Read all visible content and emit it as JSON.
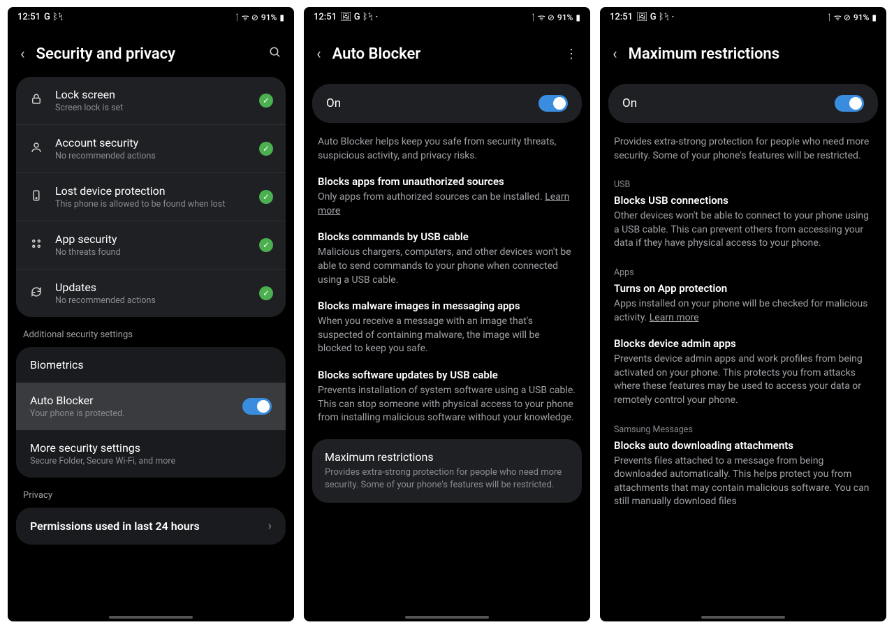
{
  "status": {
    "time": "12:51",
    "battery_text": "91%",
    "left_icons": "G ᛒᛪ",
    "left_icons2": "🖼 G ᛒᛪ ·",
    "left_icons3": "🖼 G ᛒᛪ ·",
    "right_icons": "ᛙ ᯤ ⊘"
  },
  "screen1": {
    "title": "Security and privacy",
    "items": [
      {
        "title": "Lock screen",
        "sub": "Screen lock is set"
      },
      {
        "title": "Account security",
        "sub": "No recommended actions"
      },
      {
        "title": "Lost device protection",
        "sub": "This phone is allowed to be found when lost"
      },
      {
        "title": "App security",
        "sub": "No threats found"
      },
      {
        "title": "Updates",
        "sub": "No recommended actions"
      }
    ],
    "additional_label": "Additional security settings",
    "biometrics": "Biometrics",
    "autoblocker": {
      "title": "Auto Blocker",
      "sub": "Your phone is protected."
    },
    "more": {
      "title": "More security settings",
      "sub": "Secure Folder, Secure Wi-Fi, and more"
    },
    "privacy_label": "Privacy",
    "permissions": "Permissions used in last 24 hours"
  },
  "screen2": {
    "title": "Auto Blocker",
    "on": "On",
    "intro": "Auto Blocker helps keep you safe from security threats, suspicious activity, and privacy risks.",
    "features": [
      {
        "title": "Blocks apps from unauthorized sources",
        "body": "Only apps from authorized sources can be installed.",
        "learn": "Learn more"
      },
      {
        "title": "Blocks commands by USB cable",
        "body": "Malicious chargers, computers, and other devices won't be able to send commands to your phone when connected using a USB cable."
      },
      {
        "title": "Blocks malware images in messaging apps",
        "body": "When you receive a message with an image that's suspected of containing malware, the image will be blocked to keep you safe."
      },
      {
        "title": "Blocks software updates by USB cable",
        "body": "Prevents installation of system software using a USB cable. This can stop someone with physical access to your phone from installing malicious software without your knowledge."
      }
    ],
    "max": {
      "title": "Maximum restrictions",
      "desc": "Provides extra-strong protection for people who need more security. Some of your phone's features will be restricted."
    }
  },
  "screen3": {
    "title": "Maximum restrictions",
    "on": "On",
    "intro": "Provides extra-strong protection for people who need more security. Some of your phone's features will be restricted.",
    "groups": [
      {
        "label": "USB",
        "items": [
          {
            "title": "Blocks USB connections",
            "body": "Other devices won't be able to connect to your phone using a USB cable. This can prevent others from accessing your data if they have physical access to your phone."
          }
        ]
      },
      {
        "label": "Apps",
        "items": [
          {
            "title": "Turns on App protection",
            "body": "Apps installed on your phone will be checked for malicious activity.",
            "learn": "Learn more"
          },
          {
            "title": "Blocks device admin apps",
            "body": "Prevents device admin apps and work profiles from being activated on your phone. This protects you from attacks where these features may be used to access your data or remotely control your phone."
          }
        ]
      },
      {
        "label": "Samsung Messages",
        "items": [
          {
            "title": "Blocks auto downloading attachments",
            "body": "Prevents files attached to a message from being downloaded automatically. This helps protect you from attachments that may contain malicious software. You can still manually download files"
          }
        ]
      }
    ]
  }
}
